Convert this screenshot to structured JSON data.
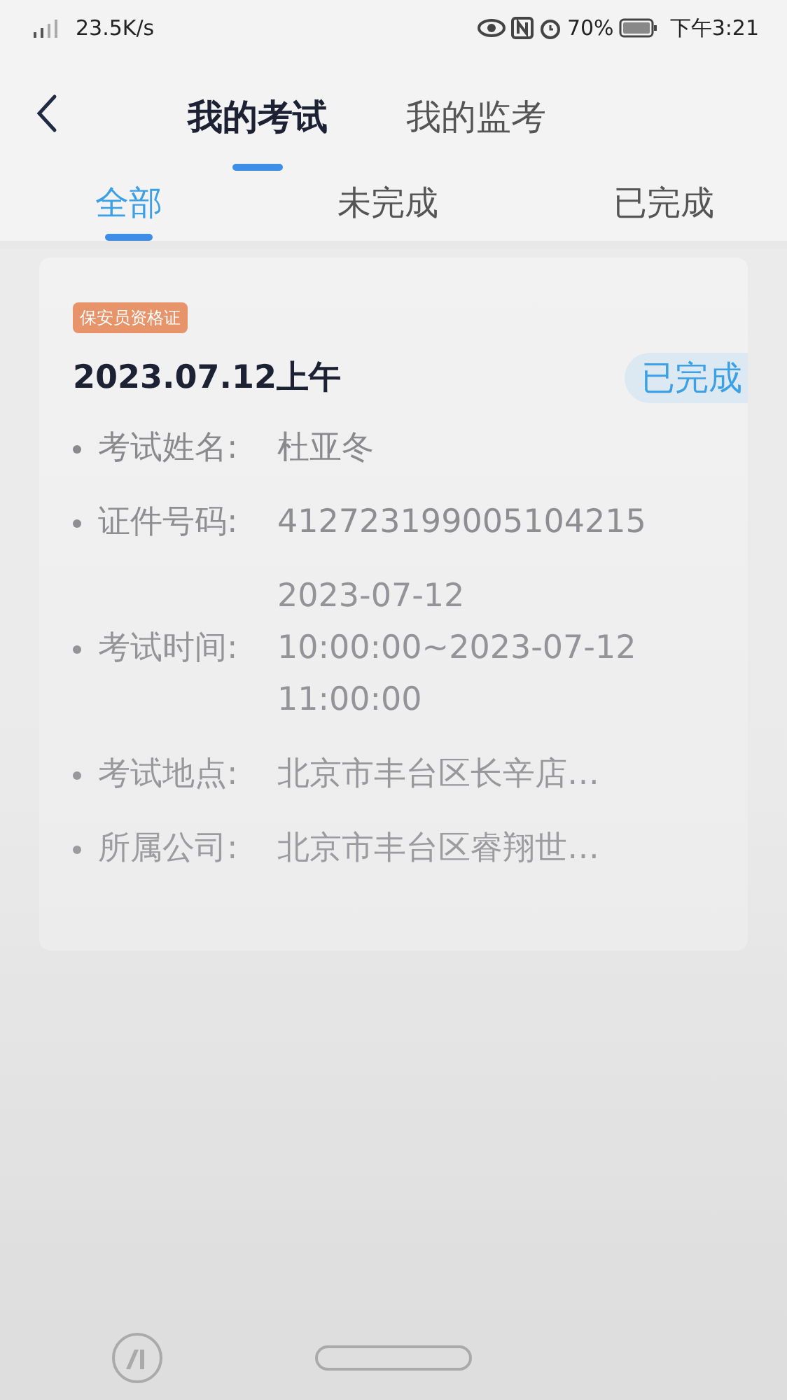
{
  "status_bar": {
    "network": "23.5K/s",
    "battery": "70%",
    "time": "下午3:21"
  },
  "header": {
    "tabs": [
      {
        "label": "我的考试",
        "selected": true
      },
      {
        "label": "我的监考",
        "selected": false
      }
    ]
  },
  "filter_tabs": [
    {
      "label": "全部",
      "selected": true
    },
    {
      "label": "未完成",
      "selected": false
    },
    {
      "label": "已完成",
      "selected": false
    }
  ],
  "exams": [
    {
      "tag": "保安员资格证",
      "date": "2023.07.12上午",
      "status": "已完成",
      "fields": [
        {
          "label": "考试姓名:",
          "value": "杜亚冬"
        },
        {
          "label": "证件号码:",
          "value": "412723199005104215"
        },
        {
          "label": "考试时间:",
          "value": "2023-07-12 10:00:00~2023-07-12 11:00:00"
        },
        {
          "label": "考试地点:",
          "value": "北京市丰台区长辛店…"
        },
        {
          "label": "所属公司:",
          "value": "北京市丰台区睿翔世…"
        }
      ]
    }
  ]
}
